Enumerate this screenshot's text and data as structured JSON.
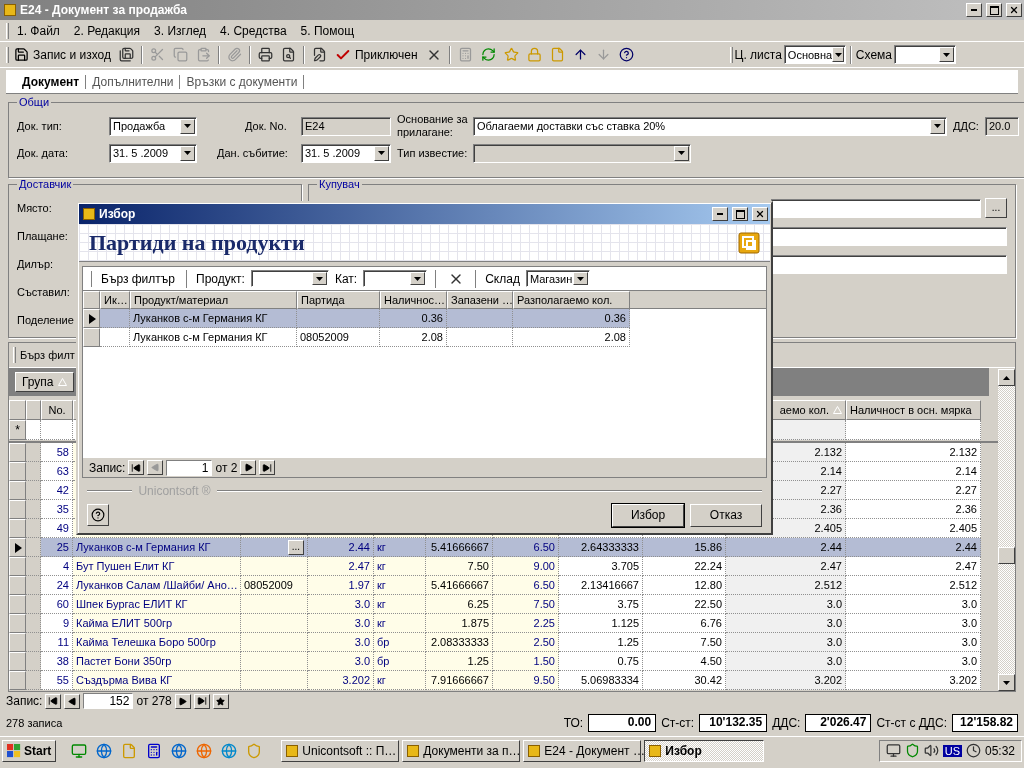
{
  "window": {
    "title": "E24 - Документ за продажба"
  },
  "menu": [
    {
      "label": "1. Файл"
    },
    {
      "label": "2. Редакция"
    },
    {
      "label": "3. Изглед"
    },
    {
      "label": "4. Средства"
    },
    {
      "label": "5. Помощ"
    }
  ],
  "toolbar": {
    "save": "Запис и изход",
    "post": "Приключен",
    "price_list_label": "Ц. листа",
    "price_list": "Основна",
    "scheme_label": "Схема"
  },
  "tabs": [
    {
      "label": "Документ",
      "selected": true
    },
    {
      "label": "Допълнителни",
      "selected": false
    },
    {
      "label": "Връзки с документи",
      "selected": false
    }
  ],
  "general": {
    "title": "Общи",
    "doc_type_label": "Док. тип:",
    "doc_type": "Продажба",
    "doc_no_label": "Док. No.",
    "doc_no": "E24",
    "basis_label": "Основание за прилагане:",
    "basis": "Облагаеми доставки със ставка 20%",
    "vat_label": "ДДС:",
    "vat": "20.0",
    "doc_date_label": "Док. дата:",
    "doc_date": "31. 5 .2009",
    "tax_event_label": "Дан. събитие:",
    "tax_event": "31. 5 .2009",
    "notice_type_label": "Тип известие:"
  },
  "supplier": {
    "title": "Доставчик",
    "labels": [
      "Място:",
      "Плащане:",
      "Дилър:",
      "Съставил:",
      "Поделение"
    ]
  },
  "buyer": {
    "title": "Купувач",
    "browse": "..."
  },
  "grid": {
    "filter_label": "Бърз филт",
    "group_label": "Група",
    "new_row_marker": "*",
    "column_headers": {
      "no": "No.",
      "column_10": "аемо кол.",
      "stock": "Наличност в осн. мярка"
    },
    "rows": [
      {
        "selected": false,
        "cells": {
          "no": "58",
          "column_10": "2.132",
          "stock": "2.132"
        }
      },
      {
        "selected": false,
        "cells": {
          "no": "63",
          "column_10": "2.14",
          "stock": "2.14"
        }
      },
      {
        "selected": false,
        "cells": {
          "no": "42",
          "column_10": "2.27",
          "stock": "2.27"
        }
      },
      {
        "selected": false,
        "cells": {
          "no": "35",
          "column_10": "2.36",
          "stock": "2.36"
        }
      },
      {
        "selected": false,
        "cells": {
          "no": "49",
          "column_10": "2.405",
          "stock": "2.405"
        }
      },
      {
        "selected": true,
        "batch_button": "...",
        "cells": {
          "no": "25",
          "column_2": "Луканков с-м Германия КГ",
          "column_4": "2.44",
          "column_5": "кг",
          "column_6": "5.41666667",
          "column_7": "6.50",
          "column_8": "2.64333333",
          "column_9": "15.86",
          "column_10": "2.44",
          "stock": "2.44"
        }
      },
      {
        "selected": false,
        "cells": {
          "no": "4",
          "column_2": "Бут Пушен Елит КГ",
          "column_4": "2.47",
          "column_5": "кг",
          "column_6": "7.50",
          "column_7": "9.00",
          "column_8": "3.705",
          "column_9": "22.24",
          "column_10": "2.47",
          "stock": "2.47"
        }
      },
      {
        "selected": false,
        "cells": {
          "no": "24",
          "column_2": "Луканков Салам /Шайби/ Ано…",
          "column_3": "08052009",
          "column_4": "1.97",
          "column_5": "кг",
          "column_6": "5.41666667",
          "column_7": "6.50",
          "column_8": "2.13416667",
          "column_9": "12.80",
          "column_10": "2.512",
          "stock": "2.512"
        }
      },
      {
        "selected": false,
        "cells": {
          "no": "60",
          "column_2": "Шпек Бургас ЕЛИТ КГ",
          "column_4": "3.0",
          "column_5": "кг",
          "column_6": "6.25",
          "column_7": "7.50",
          "column_8": "3.75",
          "column_9": "22.50",
          "column_10": "3.0",
          "stock": "3.0"
        }
      },
      {
        "selected": false,
        "cells": {
          "no": "9",
          "column_2": "Кайма ЕЛИТ 500гр",
          "column_4": "3.0",
          "column_5": "кг",
          "column_6": "1.875",
          "column_7": "2.25",
          "column_8": "1.125",
          "column_9": "6.76",
          "column_10": "3.0",
          "stock": "3.0"
        }
      },
      {
        "selected": false,
        "cells": {
          "no": "11",
          "column_2": "Кайма Телешка Боро 500гр",
          "column_4": "3.0",
          "column_5": "бр",
          "column_6": "2.08333333",
          "column_7": "2.50",
          "column_8": "1.25",
          "column_9": "7.50",
          "column_10": "3.0",
          "stock": "3.0"
        }
      },
      {
        "selected": false,
        "cells": {
          "no": "38",
          "column_2": "Пастет Бони 350гр",
          "column_4": "3.0",
          "column_5": "бр",
          "column_6": "1.25",
          "column_7": "1.50",
          "column_8": "0.75",
          "column_9": "4.50",
          "column_10": "3.0",
          "stock": "3.0"
        }
      },
      {
        "selected": false,
        "cells": {
          "no": "55",
          "column_2": "Създърма Вива КГ",
          "column_4": "3.202",
          "column_5": "кг",
          "column_6": "7.91666667",
          "column_7": "9.50",
          "column_8": "5.06983334",
          "column_9": "30.42",
          "column_10": "3.202",
          "stock": "3.202"
        }
      }
    ],
    "nav": {
      "label": "Запис:",
      "current": "152",
      "total": "от 278"
    }
  },
  "status": {
    "records": "278 записа",
    "totals": [
      {
        "label": "ТО:",
        "value": "0.00"
      },
      {
        "label": "Ст-ст:",
        "value": "10'132.35"
      },
      {
        "label": "ДДС:",
        "value": "2'026.47"
      },
      {
        "label": "Ст-ст с ДДС:",
        "value": "12'158.82"
      }
    ]
  },
  "dialog": {
    "title": "Избор",
    "heading": "Партиди на продукти",
    "filter_label": "Бърз филтър",
    "product_label": "Продукт:",
    "category_label": "Кат:",
    "warehouse_label": "Склад",
    "warehouse": "Магазин",
    "columns": [
      "Ик…",
      "Продукт/материал",
      "Партида",
      "Наличнос…",
      "Запазени …",
      "Разполагаемо кол."
    ],
    "rows": [
      {
        "selected": true,
        "cells": [
          "",
          "Луканков с-м Германия КГ",
          "",
          "0.36",
          "",
          "0.36"
        ]
      },
      {
        "selected": false,
        "cells": [
          "",
          "Луканков с-м Германия КГ",
          "08052009",
          "2.08",
          "",
          "2.08"
        ]
      }
    ],
    "nav": {
      "label": "Запис:",
      "current": "1",
      "total": "от 2"
    },
    "brand": "Unicontsoft ®",
    "buttons": [
      "Избор",
      "Отказ"
    ]
  },
  "taskbar": {
    "start": "Start",
    "tasks": [
      {
        "label": "Unicontsoft :: П…",
        "selected": false
      },
      {
        "label": "Документи за п…",
        "selected": false
      },
      {
        "label": "E24 - Документ …",
        "selected": false
      },
      {
        "label": "Избор",
        "selected": true
      }
    ],
    "language": "US",
    "clock": "05:32"
  }
}
